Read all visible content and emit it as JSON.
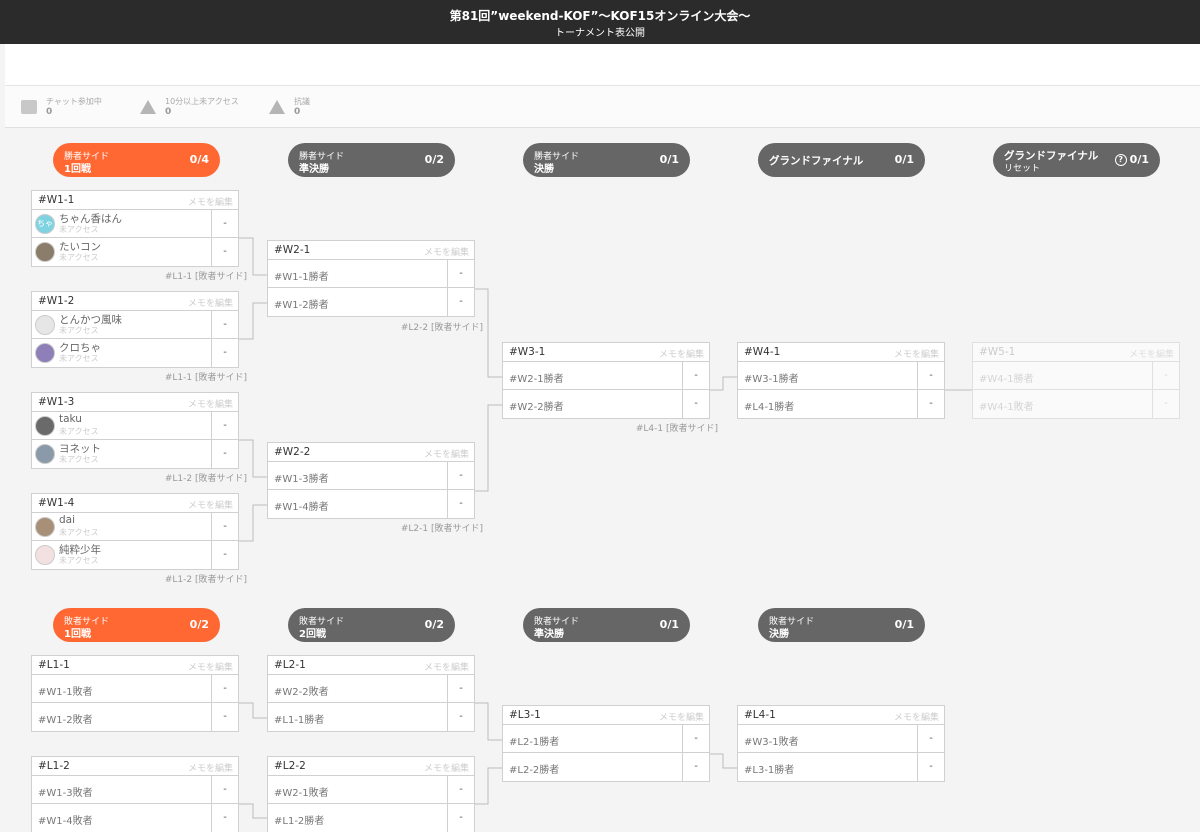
{
  "header": {
    "title": "第81回”weekend-KOF”〜KOF15オンライン大会〜",
    "subtitle": "トーナメント表公開"
  },
  "stats": {
    "chat": {
      "label": "チャット参加中",
      "value": "0"
    },
    "away": {
      "label": "10分以上未アクセス",
      "value": "0"
    },
    "abstain": {
      "label": "抗議",
      "value": "0"
    }
  },
  "columns": {
    "w1": {
      "line1": "勝者サイド",
      "line2": "1回戦",
      "count": "0/4"
    },
    "w2": {
      "line1": "勝者サイド",
      "line2": "準決勝",
      "count": "0/2"
    },
    "w3": {
      "line1": "勝者サイド",
      "line2": "決勝",
      "count": "0/1"
    },
    "gf": {
      "label": "グランドファイナル",
      "count": "0/1"
    },
    "gfr": {
      "line1": "グランドファイナル",
      "line2": "リセット",
      "count": "0/1",
      "help": "?"
    },
    "l1": {
      "line1": "敗者サイド",
      "line2": "1回戦",
      "count": "0/2"
    },
    "l2": {
      "line1": "敗者サイド",
      "line2": "2回戦",
      "count": "0/2"
    },
    "l3": {
      "line1": "敗者サイド",
      "line2": "準決勝",
      "count": "0/1"
    },
    "l4": {
      "line1": "敗者サイド",
      "line2": "決勝",
      "count": "0/1"
    }
  },
  "memo_label": "メモを編集",
  "status_unaccessed": "未アクセス",
  "matches": {
    "W1-1": {
      "id": "#W1-1",
      "p1": {
        "name": "ちゃん香はん",
        "score": "-",
        "avatar": "ちゃ"
      },
      "p2": {
        "name": "たいコン",
        "score": "-"
      },
      "loser_to": "#L1-1 [敗者サイド]"
    },
    "W1-2": {
      "id": "#W1-2",
      "p1": {
        "name": "とんかつ風味",
        "score": "-"
      },
      "p2": {
        "name": "クロちゃ",
        "score": "-"
      },
      "loser_to": "#L1-1 [敗者サイド]"
    },
    "W1-3": {
      "id": "#W1-3",
      "p1": {
        "name": "taku",
        "score": "-"
      },
      "p2": {
        "name": "ヨネット",
        "score": "-"
      },
      "loser_to": "#L1-2 [敗者サイド]"
    },
    "W1-4": {
      "id": "#W1-4",
      "p1": {
        "name": "dai",
        "score": "-"
      },
      "p2": {
        "name": "純粋少年",
        "score": "-"
      },
      "loser_to": "#L1-2 [敗者サイド]"
    },
    "W2-1": {
      "id": "#W2-1",
      "p1": {
        "name": "#W1-1勝者",
        "score": "-"
      },
      "p2": {
        "name": "#W1-2勝者",
        "score": "-"
      },
      "loser_to": "#L2-2 [敗者サイド]"
    },
    "W2-2": {
      "id": "#W2-2",
      "p1": {
        "name": "#W1-3勝者",
        "score": "-"
      },
      "p2": {
        "name": "#W1-4勝者",
        "score": "-"
      },
      "loser_to": "#L2-1 [敗者サイド]"
    },
    "W3-1": {
      "id": "#W3-1",
      "p1": {
        "name": "#W2-1勝者",
        "score": "-"
      },
      "p2": {
        "name": "#W2-2勝者",
        "score": "-"
      },
      "loser_to": "#L4-1 [敗者サイド]"
    },
    "W4-1": {
      "id": "#W4-1",
      "p1": {
        "name": "#W3-1勝者",
        "score": "-"
      },
      "p2": {
        "name": "#L4-1勝者",
        "score": "-"
      }
    },
    "W5-1": {
      "id": "#W5-1",
      "p1": {
        "name": "#W4-1勝者",
        "score": "-"
      },
      "p2": {
        "name": "#W4-1敗者",
        "score": "-"
      }
    },
    "L1-1": {
      "id": "#L1-1",
      "p1": {
        "name": "#W1-1敗者",
        "score": "-"
      },
      "p2": {
        "name": "#W1-2敗者",
        "score": "-"
      }
    },
    "L1-2": {
      "id": "#L1-2",
      "p1": {
        "name": "#W1-3敗者",
        "score": "-"
      },
      "p2": {
        "name": "#W1-4敗者",
        "score": "-"
      }
    },
    "L2-1": {
      "id": "#L2-1",
      "p1": {
        "name": "#W2-2敗者",
        "score": "-"
      },
      "p2": {
        "name": "#L1-1勝者",
        "score": "-"
      }
    },
    "L2-2": {
      "id": "#L2-2",
      "p1": {
        "name": "#W2-1敗者",
        "score": "-"
      },
      "p2": {
        "name": "#L1-2勝者",
        "score": "-"
      }
    },
    "L3-1": {
      "id": "#L3-1",
      "p1": {
        "name": "#L2-1勝者",
        "score": "-"
      },
      "p2": {
        "name": "#L2-2勝者",
        "score": "-"
      }
    },
    "L4-1": {
      "id": "#L4-1",
      "p1": {
        "name": "#W3-1敗者",
        "score": "-"
      },
      "p2": {
        "name": "#L3-1勝者",
        "score": "-"
      }
    }
  },
  "colors": {
    "accent": "#ff6833",
    "dark_pill": "#666666",
    "topbar": "#2b2b2b"
  }
}
